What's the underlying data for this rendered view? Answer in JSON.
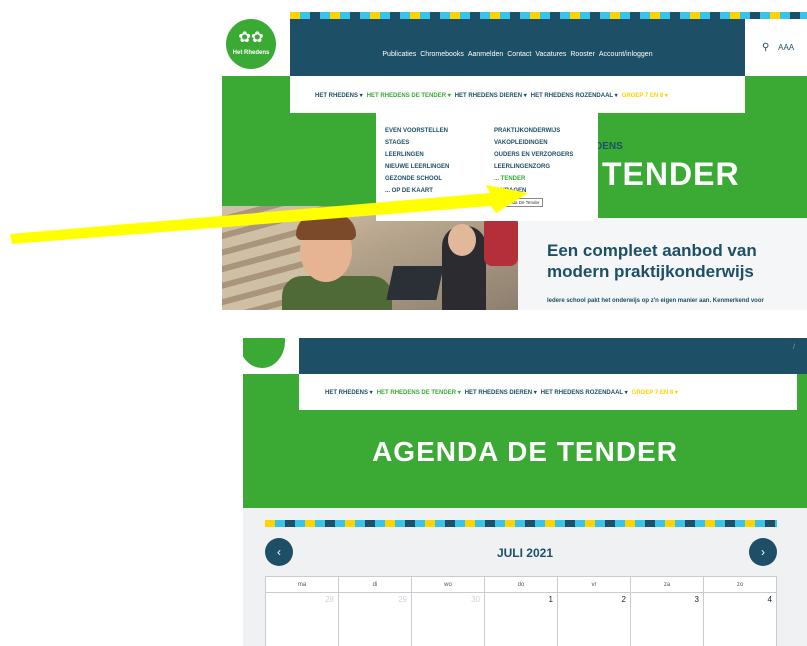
{
  "colors": {
    "navy": "#1d4f66",
    "green": "#3aaa35",
    "yellow": "#ffd200",
    "annotation_arrow": "#ffff00"
  },
  "site": {
    "logo_text": "Het Rhedens",
    "logo_icon": "leaf-icon"
  },
  "top_nav": [
    "Publicaties",
    "Chromebooks",
    "Aanmelden",
    "Contact",
    "Vacatures",
    "Rooster",
    "Account/inloggen"
  ],
  "tools": {
    "search_icon": "search-icon",
    "font_size_label": "AAA"
  },
  "main_menu": [
    {
      "label": "HET RHEDENS",
      "state": "normal"
    },
    {
      "label": "HET RHEDENS DE TENDER",
      "state": "active"
    },
    {
      "label": "HET RHEDENS DIEREN",
      "state": "normal"
    },
    {
      "label": "HET RHEDENS ROZENDAAL",
      "state": "normal"
    },
    {
      "label": "GROEP 7 EN 8",
      "state": "yellow"
    }
  ],
  "dropdown": {
    "col_a": [
      "EVEN VOORSTELLEN",
      "STAGES",
      "LEERLINGEN",
      "NIEUWE LEERLINGEN",
      "GEZONDE SCHOOL",
      "... OP DE KAART"
    ],
    "col_b": [
      "PRAKTIJKONDERWIJS",
      "VAKOPLEIDINGEN",
      "OUDERS EN VERZORGERS",
      "LEERLINGENZORG",
      "... TENDER",
      "... VRAGEN"
    ],
    "tooltip": "Agenda De Tender"
  },
  "hero": {
    "small_label": "DENS",
    "title": "TENDER",
    "heading": "Een compleet aanbod van modern praktijkonderwijs",
    "paragraph": "Iedere school pakt het onderwijs op z'n eigen manier aan. Kenmerkend voor"
  },
  "agenda": {
    "page_title": "AGENDA DE TENDER",
    "month": "JULI 2021",
    "prev_icon": "chevron-left-icon",
    "next_icon": "chevron-right-icon",
    "weekdays": [
      "ma",
      "di",
      "wo",
      "do",
      "vr",
      "za",
      "zo"
    ],
    "first_week": [
      {
        "day": "28",
        "prev": true
      },
      {
        "day": "29",
        "prev": true
      },
      {
        "day": "30",
        "prev": true
      },
      {
        "day": "1",
        "prev": false
      },
      {
        "day": "2",
        "prev": false
      },
      {
        "day": "3",
        "prev": false
      },
      {
        "day": "4",
        "prev": false
      }
    ]
  }
}
